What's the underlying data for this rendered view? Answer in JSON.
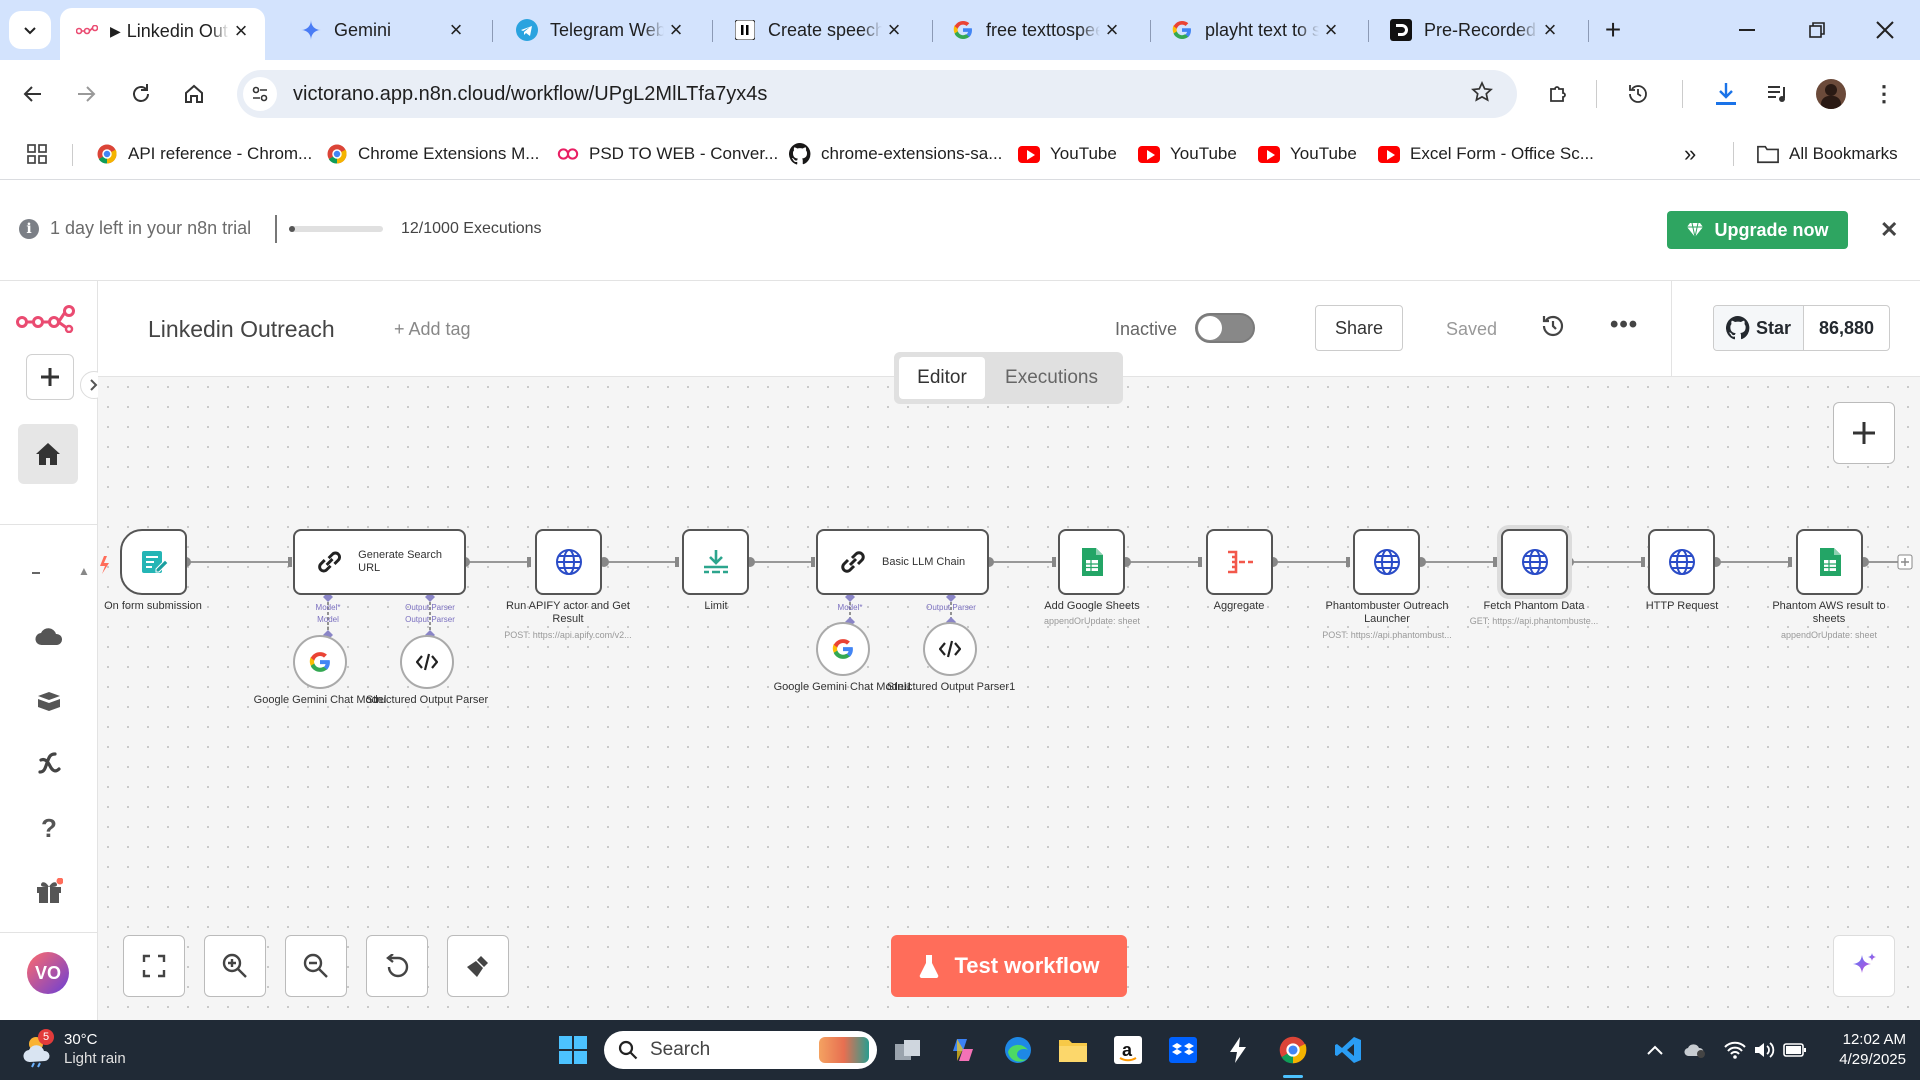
{
  "browser": {
    "tabs": [
      {
        "title": "Linkedin Outreach",
        "icon": "n8n-icon"
      },
      {
        "title": "Gemini",
        "icon": "gemini-icon"
      },
      {
        "title": "Telegram Web",
        "icon": "telegram-icon"
      },
      {
        "title": "Create speech | ",
        "icon": "elevenlabs-icon"
      },
      {
        "title": "free texttospeech",
        "icon": "google-icon"
      },
      {
        "title": "playht text to speech",
        "icon": "google-icon"
      },
      {
        "title": "Pre-Recorded Audio",
        "icon": "deepgram-icon"
      }
    ],
    "url": "victorano.app.n8n.cloud/workflow/UPgL2MlLTfa7yx4s",
    "bookmarks": [
      {
        "label": "API reference - Chrom...",
        "icon": "chrome-icon"
      },
      {
        "label": "Chrome Extensions M...",
        "icon": "chrome-icon"
      },
      {
        "label": "PSD TO WEB - Conver...",
        "icon": "link-icon"
      },
      {
        "label": "chrome-extensions-sa...",
        "icon": "github-icon"
      },
      {
        "label": "YouTube",
        "icon": "youtube-icon"
      },
      {
        "label": "YouTube",
        "icon": "youtube-icon"
      },
      {
        "label": "YouTube",
        "icon": "youtube-icon"
      },
      {
        "label": "Excel Form - Office Sc...",
        "icon": "youtube-icon"
      }
    ],
    "all_bookmarks": "All Bookmarks"
  },
  "trial": {
    "message": "1 day left in your n8n trial",
    "executions": "12/1000 Executions",
    "progress": 0.012,
    "upgrade": "Upgrade now"
  },
  "header": {
    "workflow_name": "Linkedin Outreach",
    "add_tag": "+ Add tag",
    "status": "Inactive",
    "share": "Share",
    "saved": "Saved",
    "github_star": "Star",
    "github_count": "86,880"
  },
  "switch": {
    "editor": "Editor",
    "executions": "Executions"
  },
  "nodes": {
    "form": {
      "label": "On form submission"
    },
    "search_url": {
      "title": "Generate Search URL",
      "model_port": "Model*",
      "model_sub": "Model",
      "parser_port": "Output Parser",
      "parser_sub": "Output Parser"
    },
    "gemini1": {
      "label": "Google Gemini Chat Model"
    },
    "parser1": {
      "label": "Structured Output Parser"
    },
    "apify": {
      "label": "Run APIFY actor and Get Result",
      "sub": "POST: https://api.apify.com/v2..."
    },
    "limit": {
      "label": "Limit"
    },
    "llm": {
      "title": "Basic LLM Chain",
      "model_port": "Model*",
      "parser_port": "Output Parser"
    },
    "gemini2": {
      "label": "Google Gemini Chat Model1"
    },
    "parser2": {
      "label": "Structured Output Parser1"
    },
    "sheets": {
      "label": "Add Google Sheets",
      "sub": "appendOrUpdate: sheet"
    },
    "aggregate": {
      "label": "Aggregate"
    },
    "phantom_launch": {
      "label": "Phantombuster Outreach Launcher",
      "sub": "POST: https://api.phantombust..."
    },
    "phantom_fetch": {
      "label": "Fetch Phantom Data",
      "sub": "GET: https://api.phantombuste..."
    },
    "http": {
      "label": "HTTP Request"
    },
    "phantom_sheets": {
      "label": "Phantom AWS result to sheets",
      "sub": "appendOrUpdate: sheet"
    }
  },
  "test_workflow": "Test workflow",
  "sidebar": {
    "avatar": "VO"
  },
  "taskbar": {
    "temp": "30°C",
    "condition": "Light rain",
    "weather_badge": "5",
    "search": "Search",
    "time": "12:02 AM",
    "date": "4/29/2025"
  },
  "colors": {
    "accent": "#ff6d5a",
    "upgrade": "#2ea561",
    "tab_bar": "#d3e3fd"
  }
}
